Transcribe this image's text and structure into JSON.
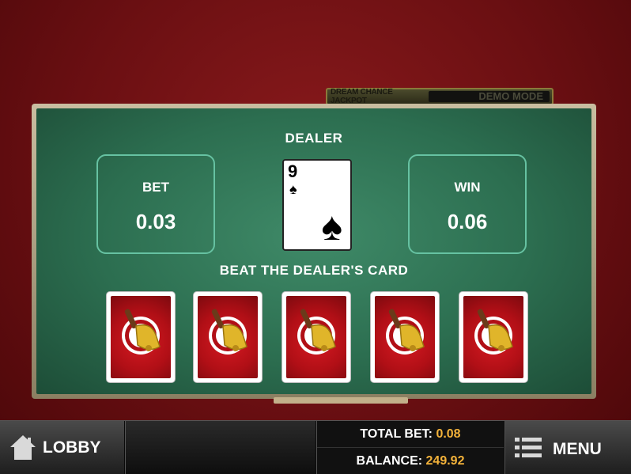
{
  "jackpot": {
    "label": "DREAM CHANCE JACKPOT",
    "value": "DEMO MODE"
  },
  "table": {
    "dealer_label": "DEALER",
    "bet": {
      "label": "BET",
      "value": "0.03"
    },
    "win": {
      "label": "WIN",
      "value": "0.06"
    },
    "dealer_card": {
      "rank": "9",
      "suit": "♠"
    },
    "instruction": "BEAT THE DEALER'S CARD",
    "pick_cards": [
      "bell-card-1",
      "bell-card-2",
      "bell-card-3",
      "bell-card-4",
      "bell-card-5"
    ]
  },
  "bottom_bar": {
    "lobby_label": "LOBBY",
    "total_bet_label": "TOTAL BET:",
    "total_bet_value": "0.08",
    "balance_label": "BALANCE:",
    "balance_value": "249.92",
    "menu_label": "MENU"
  },
  "colors": {
    "felt": "#2c6e50",
    "box_border": "#66c2a2",
    "card_red": "#c1121a",
    "amount": "#f3b23a"
  }
}
